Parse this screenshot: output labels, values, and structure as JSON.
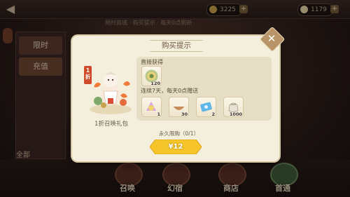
{
  "background": {
    "title": "",
    "resource_a": "3225",
    "resource_b": "1179",
    "notice": "限时商城 · 购买提示 · 每天0点刷新",
    "side_tabs": [
      "限时",
      "充值"
    ],
    "side_small": "全部",
    "bottom_buttons": [
      "召唤",
      "幻宿",
      "商店",
      "首通"
    ]
  },
  "dialog": {
    "title": "购买提示",
    "close_symbol": "✕",
    "gift": {
      "flag_text": "1折",
      "caption": "1折召唤礼包"
    },
    "direct_label": "直接获得",
    "direct_items": [
      {
        "icon": "coin-medal-icon",
        "qty": "120"
      }
    ],
    "daily_label": "连续7天，每天0点赠送",
    "daily_items": [
      {
        "icon": "magic-fan-icon",
        "qty": "1"
      },
      {
        "icon": "rice-bowl-icon",
        "qty": "30"
      },
      {
        "icon": "blue-ticket-icon",
        "qty": "2"
      },
      {
        "icon": "coin-pouch-icon",
        "qty": "1000"
      }
    ],
    "purchase_limit": "永久限购（0/1）",
    "buy_button": "¥12"
  },
  "colors": {
    "dialog_bg": "#f4efdd",
    "panel_bg": "#e7dfc5",
    "buy_gold": "#f5c52a",
    "close_bg": "#b89468"
  }
}
